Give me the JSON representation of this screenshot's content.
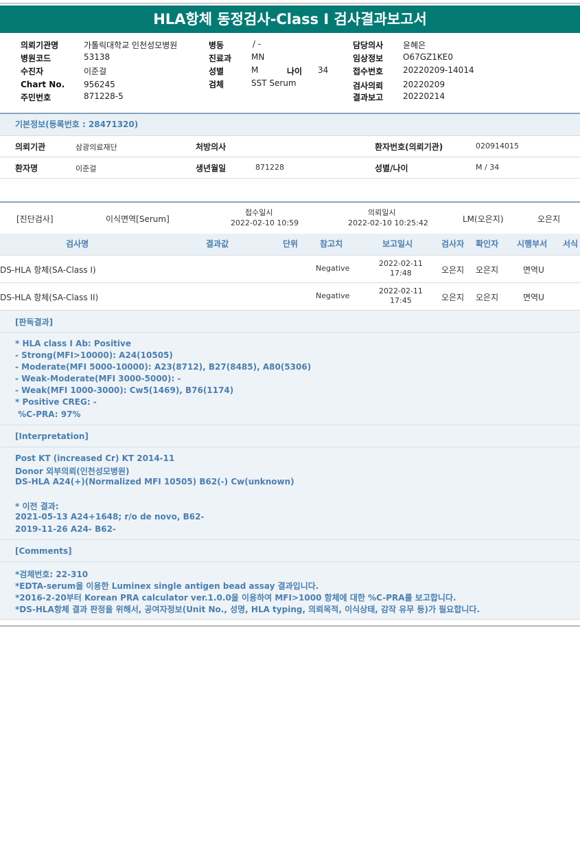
{
  "title": "HLA항체 동정검사-Class I 검사결과보고서",
  "header": {
    "col1": [
      {
        "label": "의뢰기관명",
        "value": "가톨릭대학교 인천성모병원"
      },
      {
        "label": "병원코드",
        "value": "53138"
      },
      {
        "label": "수진자",
        "value": "이준걸"
      },
      {
        "label": "Chart No.",
        "value": "956245"
      },
      {
        "label": "주민번호",
        "value": "871228-5"
      }
    ],
    "col2": [
      {
        "label": "병동",
        "value": "/ -"
      },
      {
        "label": "진료과",
        "value": "MN"
      },
      {
        "label": "성별",
        "value": "M"
      },
      {
        "label": "검체",
        "value": "SST Serum"
      }
    ],
    "age_label": "나이",
    "age_value": "34",
    "col3": [
      {
        "label": "담당의사",
        "value": "윤혜은"
      },
      {
        "label": "임상정보",
        "value": "O67GZ1KE0"
      },
      {
        "label": "접수번호",
        "value": "20220209-14014"
      },
      {
        "label": "검사의뢰",
        "value": "20220209"
      },
      {
        "label": "결과보고",
        "value": "20220214"
      }
    ]
  },
  "basic": {
    "title": "기본정보(등록번호 : 28471320)",
    "r1": {
      "l1": "의뢰기관",
      "v1": "삼광의료재단",
      "l2": "처방의사",
      "v2": "",
      "l3": "환자번호(의뢰기관)",
      "v3": "020914015"
    },
    "r2": {
      "l1": "환자명",
      "v1": "이준걸",
      "l2": "생년월일",
      "v2": "871228",
      "l3": "성별/나이",
      "v3": "M / 34"
    }
  },
  "diag": {
    "label": "[진단검사]",
    "dept": "이식면역[Serum]",
    "recv_label": "접수일시",
    "recv_value": "2022-02-10 10:59",
    "req_label": "의뢰일시",
    "req_value": "2022-02-10 10:25:42",
    "lm": "LM(오은지)",
    "person": "오은지"
  },
  "table": {
    "headers": [
      "검사명",
      "결과값",
      "단위",
      "참고치",
      "보고일시",
      "검사자",
      "확인자",
      "시행부서",
      "서식"
    ],
    "rows": [
      {
        "name": "DS-HLA 항체(SA-Class I)",
        "result": "",
        "unit": "",
        "ref": "Negative",
        "date": "2022-02-11",
        "time": "17:48",
        "tester": "오은지",
        "checker": "오은지",
        "dept": "면역U"
      },
      {
        "name": "DS-HLA 항체(SA-Class II)",
        "result": "",
        "unit": "",
        "ref": "Negative",
        "date": "2022-02-11",
        "time": "17:45",
        "tester": "오은지",
        "checker": "오은지",
        "dept": "면역U"
      }
    ]
  },
  "judgment": {
    "title": "[판독결과]",
    "lines": [
      "* HLA class I Ab: Positive",
      "- Strong(MFI>10000): A24(10505)",
      "- Moderate(MFI 5000-10000): A23(8712), B27(8485), A80(5306)",
      "- Weak-Moderate(MFI 3000-5000): -",
      "- Weak(MFI 1000-3000): Cw5(1469), B76(1174)",
      "* Positive CREG: -",
      " %C-PRA: 97%"
    ]
  },
  "interpretation": {
    "title": "[Interpretation]",
    "lines": [
      "Post KT (increased Cr) KT 2014-11",
      "Donor 외부의뢰(인천성모병원)",
      "DS-HLA A24(+)(Normalized MFI 10505) B62(-) Cw(unknown)",
      "",
      "* 이전 결과:",
      "2021-05-13 A24+1648; r/o de novo, B62-",
      "2019-11-26 A24- B62-"
    ]
  },
  "comments": {
    "title": "[Comments]",
    "lines": [
      "*검체번호: 22-310",
      "*EDTA-serum을 이용한 Luminex single antigen bead assay 결과입니다.",
      "*2016-2-20부터 Korean PRA calculator ver.1.0.0을 이용하여 MFI>1000 항체에 대한 %C-PRA를 보고합니다.",
      "*DS-HLA항체 결과 판정을 위해서, 공여자정보(Unit No., 성명, HLA typing, 의뢰목적, 이식상태, 감작 유무 등)가 필요합니다."
    ]
  }
}
